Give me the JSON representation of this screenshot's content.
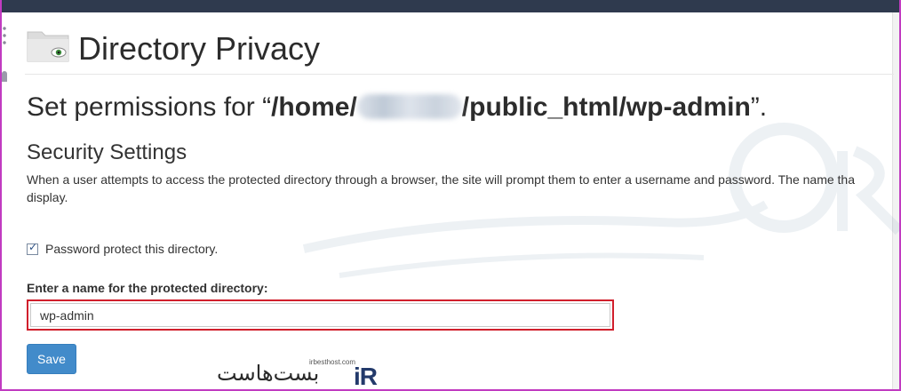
{
  "header": {
    "title": "Directory Privacy",
    "icon": "folder-eye-icon"
  },
  "permissions": {
    "prefix": "Set permissions for “",
    "path_start": "/home/",
    "path_end": "/public_html/wp-admin",
    "suffix": "”."
  },
  "security": {
    "heading": "Security Settings",
    "description_line1": "When a user attempts to access the protected directory through a browser, the site will prompt them to enter a username and password. The name tha",
    "description_line2": "display."
  },
  "form": {
    "checkbox_label": "Password protect this directory.",
    "checkbox_checked": true,
    "name_label": "Enter a name for the protected directory:",
    "name_value": "wp-admin",
    "save_label": "Save"
  },
  "branding": {
    "logo_text": "iR",
    "logo_fa": "بست‌هاست",
    "logo_url": "irbesthost.com"
  },
  "colors": {
    "topbar": "#2f3a4e",
    "button": "#428bca",
    "highlight": "#d11f2c",
    "frame": "#c13bc1"
  }
}
